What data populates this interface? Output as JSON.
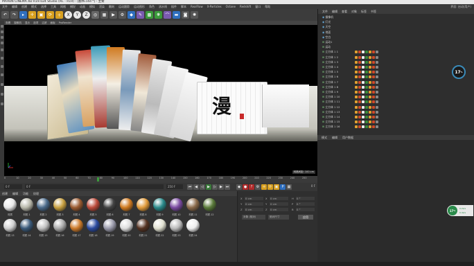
{
  "window": {
    "title": "MAXON CINEMA 4D R19.024 Studio (RC - R19) - [翻书.c4d *] - 主要",
    "right_label": "界面: 启动(用户)"
  },
  "menu": [
    "文件",
    "编辑",
    "创建",
    "模式",
    "选择",
    "工具",
    "网格",
    "捕捉",
    "动画",
    "模拟",
    "渲染",
    "雕刻",
    "运动跟踪",
    "运动图形",
    "角色",
    "流水线",
    "插件",
    "脚本",
    "RealFlow",
    "X-Particles",
    "Octane",
    "Redshift",
    "窗口",
    "帮助"
  ],
  "toolbar": {
    "icons": [
      "undo-icon",
      "redo-icon",
      "select-icon",
      "move-icon",
      "scale-icon",
      "rotate-icon",
      "x-axis",
      "y-axis",
      "z-axis",
      "world-icon",
      "render-view-icon",
      "render-icon",
      "render-settings-icon",
      "cube-icon",
      "pen-icon",
      "subdivide-icon",
      "cloner-icon",
      "deformer-icon",
      "floor-icon",
      "camera-icon",
      "light-icon"
    ],
    "axis_labels": [
      "X",
      "Y",
      "Z"
    ]
  },
  "viewport": {
    "menu": [
      "查看",
      "摄像机",
      "显示",
      "选项",
      "过滤",
      "面板",
      "ProRender"
    ],
    "title_text": "漫",
    "status": "网格间距: 100 cm"
  },
  "timeline": {
    "ticks": [
      "0",
      "10",
      "20",
      "30",
      "40",
      "50",
      "60",
      "70",
      "80",
      "90",
      "100",
      "110",
      "120",
      "130",
      "140",
      "150",
      "160",
      "170",
      "180",
      "190",
      "200",
      "210",
      "220",
      "230",
      "240",
      "250"
    ],
    "current": "0 F",
    "start": "0 F",
    "end": "250 F",
    "current_right": "0 F"
  },
  "materials": {
    "menu": [
      "创建",
      "编辑",
      "功能",
      "纹理"
    ],
    "items": [
      {
        "label": "材质",
        "color": "#e8e8e8"
      },
      {
        "label": "材质.1",
        "color": "#b7b7aa"
      },
      {
        "label": "材质.2",
        "color": "#4a6a8a"
      },
      {
        "label": "材质.3",
        "color": "#c8a040"
      },
      {
        "label": "材质.4",
        "color": "#9a5a30"
      },
      {
        "label": "材质.5",
        "color": "#bb4a3a"
      },
      {
        "label": "材质.6",
        "color": "#444444"
      },
      {
        "label": "材质.7",
        "color": "#d07a20"
      },
      {
        "label": "材质.8",
        "color": "#e09a3a"
      },
      {
        "label": "材质.9",
        "color": "#2a8a8a"
      },
      {
        "label": "材质.10",
        "color": "#7a4aa0"
      },
      {
        "label": "材质.11",
        "color": "#8a6a4a"
      },
      {
        "label": "材质.12",
        "color": "#5a7a3a"
      },
      {
        "label": "材质.13",
        "color": "#d0d0d0"
      },
      {
        "label": "材质.14",
        "color": "#3a5a7a"
      },
      {
        "label": "材质.15",
        "color": "#c0c0c0"
      },
      {
        "label": "材质.16",
        "color": "#aaaaaa"
      },
      {
        "label": "材质.17",
        "color": "#cc7a2a"
      },
      {
        "label": "材质.18",
        "color": "#2a4aa0"
      },
      {
        "label": "材质.19",
        "color": "#9a9aaa"
      },
      {
        "label": "材质.20",
        "color": "#dddddd"
      },
      {
        "label": "材质.21",
        "color": "#553322"
      },
      {
        "label": "材质.22",
        "color": "#e0e0d0"
      },
      {
        "label": "材质.23",
        "color": "#bbbbbb"
      },
      {
        "label": "材质.24",
        "color": "#eeeeee"
      }
    ]
  },
  "coords": {
    "rows": [
      {
        "axis": "X",
        "pos": "0 cm",
        "axis2": "X",
        "size": "0 cm",
        "axis3": "H",
        "rot": "0 °"
      },
      {
        "axis": "Y",
        "pos": "0 cm",
        "axis2": "Y",
        "size": "0 cm",
        "axis3": "P",
        "rot": "0 °"
      },
      {
        "axis": "Z",
        "pos": "0 cm",
        "axis2": "Z",
        "size": "0 cm",
        "axis3": "B",
        "rot": "0 °"
      }
    ],
    "mode1": "对象 (相对)",
    "mode2": "绝对尺寸",
    "apply": "应用"
  },
  "objects": {
    "menu": [
      "文件",
      "编辑",
      "查看",
      "对象",
      "标签",
      "书签"
    ],
    "rows": [
      "摄像机",
      "灯光",
      "天空",
      "地面",
      "空白",
      "运动1",
      "运动",
      "立方体 1 1",
      "立方体 1 2",
      "立方体 1 3",
      "立方体 1 4",
      "立方体 1 5",
      "立方体 1 6",
      "立方体 1 7",
      "立方体 1 8",
      "立方体 1 9",
      "立方体 1 10",
      "立方体 1 11",
      "立方体 1 12",
      "立方体 1 13",
      "立方体 1 14",
      "立方体 1 15",
      "立方体 1 16"
    ]
  },
  "attributes": {
    "menu": [
      "模式",
      "编辑",
      "用户数据"
    ]
  },
  "gauges": [
    {
      "value": "17",
      "unit": "%"
    },
    {
      "value": "17",
      "unit": "%",
      "extra1": "0.2k/s",
      "extra2": "0.4k/s"
    }
  ]
}
